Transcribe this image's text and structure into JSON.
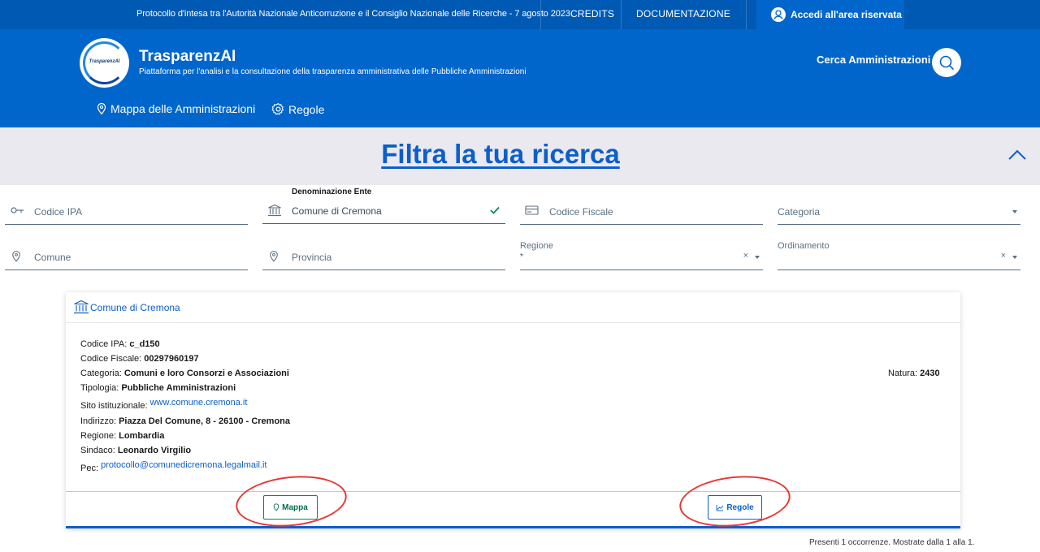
{
  "topbar": {
    "protocol": "Protocollo d'intesa tra l'Autorità Nazionale Anticorruzione e il Consiglio Nazionale delle Ricerche - 7 agosto 2023",
    "credits": "CREDITS",
    "docs": "DOCUMENTAZIONE",
    "login": "Accedi all'area riservata"
  },
  "header": {
    "logo_text": "TrasparenzAI",
    "brand": "TrasparenzAI",
    "tagline": "Piattaforma per l'analisi e la consultazione della trasparenza amministrativa delle Pubbliche Amministrazioni",
    "search_label": "Cerca Amministrazioni",
    "nav": [
      "Mappa delle Amministrazioni",
      "Regole"
    ]
  },
  "filter": {
    "title": "Filtra la tua ricerca",
    "fields": {
      "codice_ipa": "Codice IPA",
      "denominazione_label": "Denominazione Ente",
      "denominazione_value": "Comune di Cremona",
      "codice_fiscale": "Codice Fiscale",
      "categoria": "Categoria",
      "comune": "Comune",
      "provincia": "Provincia",
      "regione_label": "Regione",
      "regione_value": "*",
      "ordinamento_label": "Ordinamento"
    }
  },
  "card": {
    "title": "Comune di Cremona",
    "rows": {
      "codice_ipa_label": "Codice IPA:",
      "codice_ipa": "c_d150",
      "codice_fiscale_label": "Codice Fiscale:",
      "codice_fiscale": "00297960197",
      "categoria_label": "Categoria:",
      "categoria": "Comuni e loro Consorzi e Associazioni",
      "tipologia_label": "Tipologia:",
      "tipologia": "Pubbliche Amministrazioni",
      "sito_label": "Sito istituzionale:",
      "sito": "www.comune.cremona.it",
      "indirizzo_label": "Indirizzo:",
      "indirizzo": "Piazza Del Comune, 8 - 26100 - Cremona",
      "regione_label": "Regione:",
      "regione": "Lombardia",
      "sindaco_label": "Sindaco:",
      "sindaco": "Leonardo Virgilio",
      "pec_label": "Pec:",
      "pec": "protocollo@comunedicremona.legalmail.it",
      "natura_label": "Natura:",
      "natura": "2430"
    },
    "buttons": {
      "map": "Mappa",
      "rules": "Regole"
    }
  },
  "summary": "Presenti 1 occorrenze. Mostrate dalla 1 alla 1.",
  "colors": {
    "primary": "#0066cc",
    "topbar": "#0059b3",
    "success": "#008758",
    "annotation": "#e53935"
  }
}
